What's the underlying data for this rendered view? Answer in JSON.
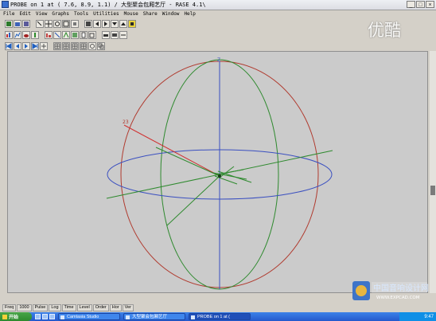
{
  "window": {
    "title": "PROBE on 1 at ( 7.6, 8.9, 1.1) / 大型聚会包厢艺厅 - RASE 4.1\\",
    "min_label": "_",
    "max_label": "□",
    "close_label": "×"
  },
  "menu": [
    "File",
    "Edit",
    "View",
    "Graphs",
    "Tools",
    "Utilities",
    "Mouse",
    "Share",
    "Window",
    "Help"
  ],
  "viewport": {
    "label_top": "Z",
    "label_probe": "23",
    "colors": {
      "background": "#cbcbcb",
      "meridian_red": "#b03a2e",
      "meridian_green": "#2f8a2f",
      "equator_blue": "#3a4fc0",
      "ray_red": "#d03030"
    }
  },
  "statusbar": [
    "Freq",
    "1000",
    "Pulse",
    "Log",
    "Time",
    "Level",
    "Order",
    "Hor",
    "Ver"
  ],
  "taskbar": {
    "start_label": "开始",
    "tasks": [
      "Camtasia Studio",
      "大型聚会包厢艺厅",
      "PROBE on 1 at ("
    ],
    "tray_time": "9:47"
  },
  "watermark": {
    "brand": "优酷",
    "site": "中国音响设计网",
    "site_url_text": "WWW.EXPCAD.COM"
  }
}
